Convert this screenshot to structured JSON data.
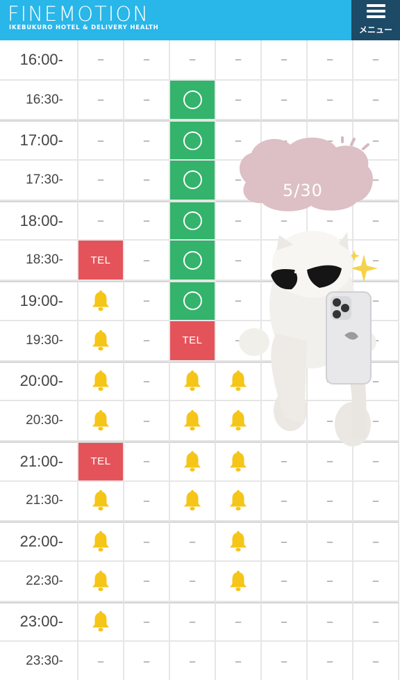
{
  "header": {
    "logo": "FINEMOTION",
    "subtitle": "IKEBUKURO HOTEL & DELIVERY HEALTH",
    "menu_label": "メニュー",
    "bg_color": "#29b6e8",
    "menu_bg_color": "#1d4a66"
  },
  "legend": {
    "available": "circle-icon",
    "tel": "TEL",
    "waiting": "bell-icon",
    "none": "–"
  },
  "colors": {
    "available": "#33b36b",
    "tel": "#e5535a",
    "bell": "#f5c518"
  },
  "overlay": {
    "date_label": "5/30",
    "image": "cat-with-sunglasses-and-phone"
  },
  "schedule": [
    {
      "time": "16:00-",
      "cells": [
        "-",
        "-",
        "-",
        "-",
        "-",
        "-",
        "-"
      ]
    },
    {
      "time": "16:30-",
      "cells": [
        "-",
        "-",
        "O",
        "-",
        "-",
        "-",
        "-"
      ]
    },
    {
      "time": "17:00-",
      "cells": [
        "-",
        "-",
        "O",
        "-",
        "-",
        "-",
        "-"
      ]
    },
    {
      "time": "17:30-",
      "cells": [
        "-",
        "-",
        "O",
        "-",
        "-",
        "-",
        "-"
      ]
    },
    {
      "time": "18:00-",
      "cells": [
        "-",
        "-",
        "O",
        "-",
        "-",
        "-",
        "-"
      ]
    },
    {
      "time": "18:30-",
      "cells": [
        "TEL",
        "-",
        "O",
        "-",
        "-",
        "-",
        "-"
      ]
    },
    {
      "time": "19:00-",
      "cells": [
        "B",
        "-",
        "O",
        "-",
        "-",
        "-",
        "-"
      ]
    },
    {
      "time": "19:30-",
      "cells": [
        "B",
        "-",
        "TEL",
        "-",
        "-",
        "-",
        "-"
      ]
    },
    {
      "time": "20:00-",
      "cells": [
        "B",
        "-",
        "B",
        "B",
        "-",
        "-",
        "-"
      ]
    },
    {
      "time": "20:30-",
      "cells": [
        "B",
        "-",
        "B",
        "B",
        "-",
        "-",
        "-"
      ]
    },
    {
      "time": "21:00-",
      "cells": [
        "TEL",
        "-",
        "B",
        "B",
        "-",
        "-",
        "-"
      ]
    },
    {
      "time": "21:30-",
      "cells": [
        "B",
        "-",
        "B",
        "B",
        "-",
        "-",
        "-"
      ]
    },
    {
      "time": "22:00-",
      "cells": [
        "B",
        "-",
        "-",
        "B",
        "-",
        "-",
        "-"
      ]
    },
    {
      "time": "22:30-",
      "cells": [
        "B",
        "-",
        "-",
        "B",
        "-",
        "-",
        "-"
      ]
    },
    {
      "time": "23:00-",
      "cells": [
        "B",
        "-",
        "-",
        "-",
        "-",
        "-",
        "-"
      ]
    },
    {
      "time": "23:30-",
      "cells": [
        "-",
        "-",
        "-",
        "-",
        "-",
        "-",
        "-"
      ]
    }
  ]
}
